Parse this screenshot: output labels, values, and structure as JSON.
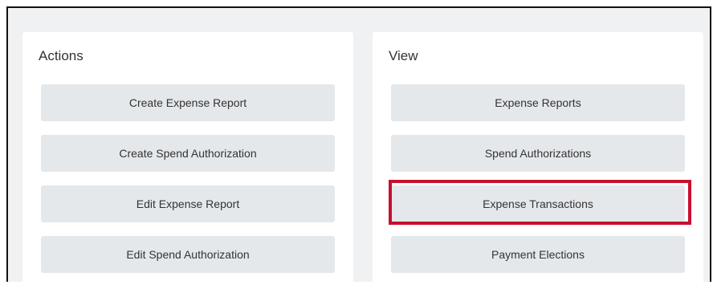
{
  "actions": {
    "title": "Actions",
    "buttons": [
      "Create Expense Report",
      "Create Spend Authorization",
      "Edit Expense Report",
      "Edit Spend Authorization"
    ]
  },
  "view": {
    "title": "View",
    "buttons": [
      "Expense Reports",
      "Spend Authorizations",
      "Expense Transactions",
      "Payment Elections"
    ]
  },
  "colors": {
    "highlight": "#c8102e",
    "button_bg": "#e5e8eb",
    "panel_bg": "#ffffff",
    "page_bg": "#f0f1f2"
  }
}
